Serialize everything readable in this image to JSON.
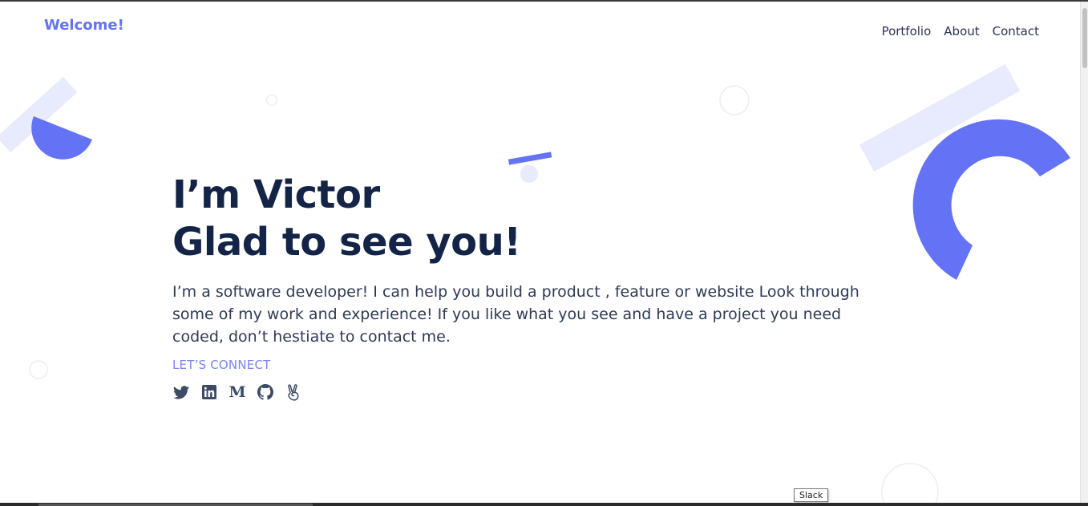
{
  "header": {
    "brand": "Welcome!",
    "nav": [
      {
        "label": "Portfolio"
      },
      {
        "label": "About"
      },
      {
        "label": "Contact"
      }
    ]
  },
  "hero": {
    "title_line1": "I’m Victor",
    "title_line2": "Glad to see you!",
    "description": "I’m a software developer! I can help you build a product , feature or website Look through some of my work and experience! If you like what you see and have a project you need coded, don’t hestiate to contact me.",
    "cta_label": "LET’S CONNECT"
  },
  "socials": [
    {
      "icon": "twitter-icon"
    },
    {
      "icon": "linkedin-icon"
    },
    {
      "icon": "medium-icon",
      "glyph": "M"
    },
    {
      "icon": "github-icon"
    },
    {
      "icon": "angellist-icon"
    }
  ],
  "tooltip": {
    "text": "Slack"
  },
  "colors": {
    "accent": "#6472f5",
    "accent_light": "#e8eafd",
    "heading": "#132447",
    "text": "#2e3a55",
    "cta": "#7a84f5",
    "icon": "#3c4a66"
  }
}
